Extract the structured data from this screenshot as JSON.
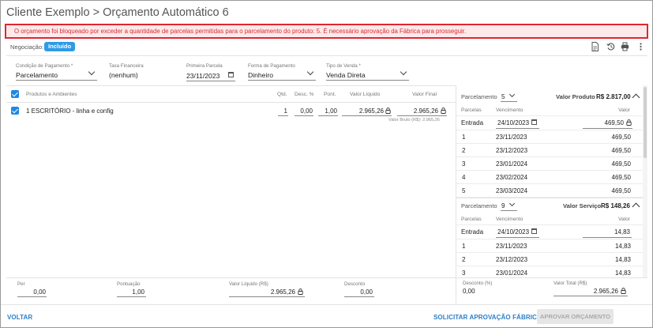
{
  "title": "Cliente Exemplo > Orçamento Automático 6",
  "alert": "O orçamento foi bloqueado por exceder a quantidade de parcelas permitidas para o parcelamento do produto: 5. É necessário aprovação da Fábrica para prosseguir.",
  "negociacao": {
    "label": "Negociação:",
    "badge": "Incluído"
  },
  "toolbar_icons": [
    "document-icon",
    "history-icon",
    "print-icon",
    "more-vertical-icon"
  ],
  "fields": {
    "condicao": {
      "label": "Condição de Pagamento *",
      "value": "Parcelamento"
    },
    "taxa": {
      "label": "Taxa Financeira",
      "value": "(nenhum)"
    },
    "primeira": {
      "label": "Primeira Parcela",
      "value": "23/11/2023"
    },
    "forma": {
      "label": "Forma de Pagamento",
      "value": "Dinheiro"
    },
    "tipo": {
      "label": "Tipo de Venda *",
      "value": "Venda Direta"
    }
  },
  "products": {
    "headers": {
      "name": "Produtos e Ambientes",
      "qtd": "Qtd.",
      "desc": "Desc. %",
      "pont": "Pont.",
      "liquido": "Valor Líquido",
      "final": "Valor Final"
    },
    "row": {
      "name": "1 ESCRITÓRIO - linha e config",
      "qtd": "1",
      "desc": "0,00",
      "pont": "1,00",
      "liquido": "2.965,26",
      "final": "2.965,26",
      "bruto": "Valor Bruto (R$): 2.965,26"
    }
  },
  "totals": {
    "per": {
      "label": "Per",
      "value": "0,00"
    },
    "pontuacao": {
      "label": "Pontuação",
      "value": "1,00"
    },
    "liquido": {
      "label": "Valor Líquido (R$)",
      "value": "2.965,26"
    },
    "desconto": {
      "label": "Desconto",
      "value": "0,00"
    },
    "desconto_pct": {
      "label": "Desconto (%)",
      "value": "0,00"
    },
    "total": {
      "label": "Valor Total (R$)",
      "value": "2.965,26"
    }
  },
  "produto_plan": {
    "parcelamento_label": "Parcelamento",
    "parcelamento_value": "5",
    "valor_label": "Valor Produto",
    "valor_value": "R$ 2.817,00",
    "headers": {
      "parcelas": "Parcelas",
      "vencimento": "Vencimento",
      "valor": "Valor"
    },
    "entrada": {
      "label": "Entrada",
      "date": "24/10/2023",
      "value": "469,50"
    },
    "rows": [
      {
        "n": "1",
        "date": "23/11/2023",
        "value": "469,50"
      },
      {
        "n": "2",
        "date": "23/12/2023",
        "value": "469,50"
      },
      {
        "n": "3",
        "date": "23/01/2024",
        "value": "469,50"
      },
      {
        "n": "4",
        "date": "23/02/2024",
        "value": "469,50"
      },
      {
        "n": "5",
        "date": "23/03/2024",
        "value": "469,50"
      }
    ]
  },
  "servico_plan": {
    "parcelamento_label": "Parcelamento",
    "parcelamento_value": "9",
    "valor_label": "Valor Serviço",
    "valor_value": "R$ 148,26",
    "headers": {
      "parcelas": "Parcelas",
      "vencimento": "Vencimento",
      "valor": "Valor"
    },
    "entrada": {
      "label": "Entrada",
      "date": "24/10/2023",
      "value": "14,83"
    },
    "rows": [
      {
        "n": "1",
        "date": "23/11/2023",
        "value": "14,83"
      },
      {
        "n": "2",
        "date": "23/12/2023",
        "value": "14,83"
      },
      {
        "n": "3",
        "date": "23/01/2024",
        "value": "14,83"
      }
    ]
  },
  "footer": {
    "voltar": "VOLTAR",
    "solicitar": "SOLICITAR APROVAÇÃO FÁBRICA",
    "aprovar": "APROVAR ORÇAMENTO"
  }
}
